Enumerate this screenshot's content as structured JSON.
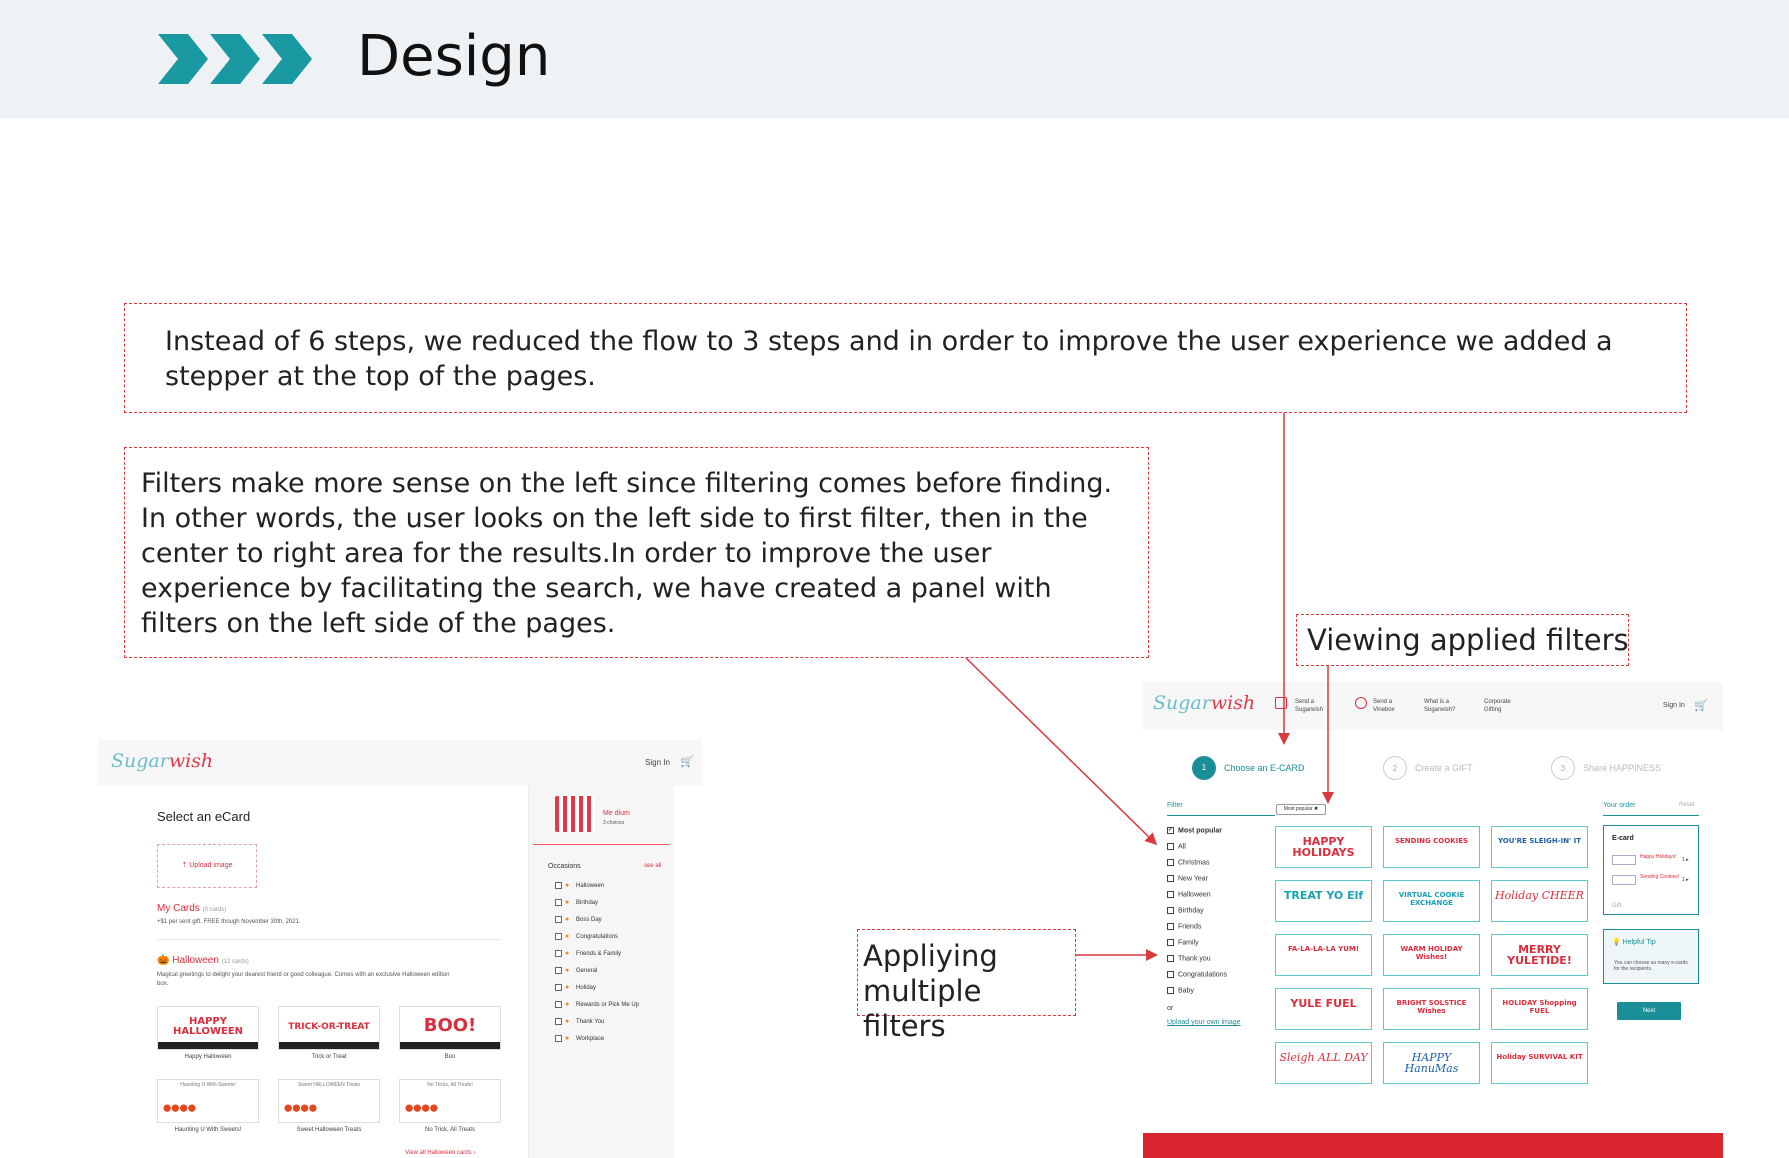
{
  "header": {
    "title": "Design",
    "chevron_color": "#1b99a3",
    "background": "#eef2f5"
  },
  "notes": {
    "steps": "Instead of 6 steps, we reduced the flow to 3 steps and in order to improve the user experience we added a stepper at the top of the pages.",
    "filters": "Filters make more sense on the left since filtering comes before finding. In other words, the user looks on the left side to first filter, then in the center to right area for the results.In order to improve the user experience by facilitating the search, we have created a panel with filters on the left side of the pages.",
    "viewing": "Viewing applied filters",
    "applying": "Appliying multiple filters"
  },
  "before": {
    "logo_sugar": "Sugar",
    "logo_wish": "wish",
    "sign_in": "Sign In",
    "select_title": "Select an eCard",
    "upload_label": "⇡ Upload image",
    "my_cards_label": "My Cards",
    "my_cards_count": "(0 cards)",
    "my_cards_sub": "+$1 per sent gift. FREE though November 30th, 2021.",
    "halloween_label": "Halloween",
    "halloween_count": "(12 cards)",
    "halloween_desc": "Magical greetings to delight your dearest  friend or good colleague.  Comes with an exclusive Halloween edition box.",
    "cards": [
      {
        "art": "HAPPY HALLOWEEN",
        "caption": "Happy Halloween"
      },
      {
        "art": "TRICK-OR-TREAT",
        "caption": "Trick or Treat"
      },
      {
        "art": "BOO!",
        "caption": "Boo"
      },
      {
        "top": "Haunting U With Sweets!",
        "caption": "Haunting U With Sweets!"
      },
      {
        "top": "Sweet HALLOWEEN Treats",
        "caption": "Sweet Halloween Treats"
      },
      {
        "top": "No Tricks, All Treats!",
        "caption": "No Trick, All Treats"
      }
    ],
    "view_all": "View all Halloween cards ›",
    "order_name": "Me dium",
    "order_sub": "3 choices",
    "occasions_title": "Occasions",
    "see_all": "see all",
    "occasions": [
      "Halloween",
      "Birthday",
      "Boss Day",
      "Congratulations",
      "Friends & Family",
      "General",
      "Holiday",
      "Rewards or Pick Me Up",
      "Thank You",
      "Workplace"
    ]
  },
  "after": {
    "logo_sugar": "Sugar",
    "logo_wish": "wish",
    "nav": [
      {
        "line1": "Send a",
        "line2": "Sugarwish"
      },
      {
        "line1": "Send a",
        "line2": "Vinebox"
      },
      {
        "line1": "What is a",
        "line2": "Sugarwish?"
      },
      {
        "line1": "Corporate",
        "line2": "Gifting"
      }
    ],
    "sign_in": "Sign In",
    "steps": [
      {
        "num": "1",
        "label": "Choose an E-CARD",
        "active": true
      },
      {
        "num": "2",
        "label": "Create a GIFT",
        "active": false
      },
      {
        "num": "3",
        "label": "Share HAPPINESS",
        "active": false
      }
    ],
    "filter_title": "Filter",
    "filters": [
      {
        "label": "Most popular",
        "checked": true
      },
      {
        "label": "All",
        "checked": false
      },
      {
        "label": "Christmas",
        "checked": false
      },
      {
        "label": "New Year",
        "checked": false
      },
      {
        "label": "Halloween",
        "checked": false
      },
      {
        "label": "Birthday",
        "checked": false
      },
      {
        "label": "Friends",
        "checked": false
      },
      {
        "label": "Family",
        "checked": false
      },
      {
        "label": "Thank you",
        "checked": false
      },
      {
        "label": "Congratulations",
        "checked": false
      },
      {
        "label": "Baby",
        "checked": false
      }
    ],
    "or_label": "or",
    "upload_link": "Upload your own image",
    "applied_chip": "Most popular ✖",
    "ecards": [
      {
        "text": "HAPPY HOLIDAYS"
      },
      {
        "text": "SENDING COOKIES"
      },
      {
        "text": "YOU'RE SLEIGH-IN' IT"
      },
      {
        "text": "TREAT YO Elf"
      },
      {
        "text": "VIRTUAL COOKIE EXCHANGE"
      },
      {
        "text": "Holiday CHEER"
      },
      {
        "text": "FA-LA-LA-LA YUM!"
      },
      {
        "text": "WARM HOLIDAY Wishes!"
      },
      {
        "text": "MERRY YULETIDE!"
      },
      {
        "text": "YULE FUEL"
      },
      {
        "text": "BRIGHT SOLSTICE Wishes"
      },
      {
        "text": "HOLIDAY Shopping FUEL"
      },
      {
        "text": "Sleigh ALL DAY"
      },
      {
        "text": "HAPPY HanuMas"
      },
      {
        "text": "Holiday SURVIVAL KIT"
      }
    ],
    "order_title": "Your order",
    "reset": "Reset",
    "ecard_label": "E-card",
    "order_items": [
      {
        "name": "Happy Holidays!",
        "qty": "1 ▸"
      },
      {
        "name": "Sending Cookies!",
        "qty": "1 ▸"
      }
    ],
    "gift_label": "Gift",
    "tip_title": "💡 Helpful Tip",
    "tip_text": "You can choose as many e-cards for the recipients.",
    "next_label": "Next",
    "colors": {
      "accent": "#1b8f98",
      "brand_red": "#d92f3e"
    }
  }
}
